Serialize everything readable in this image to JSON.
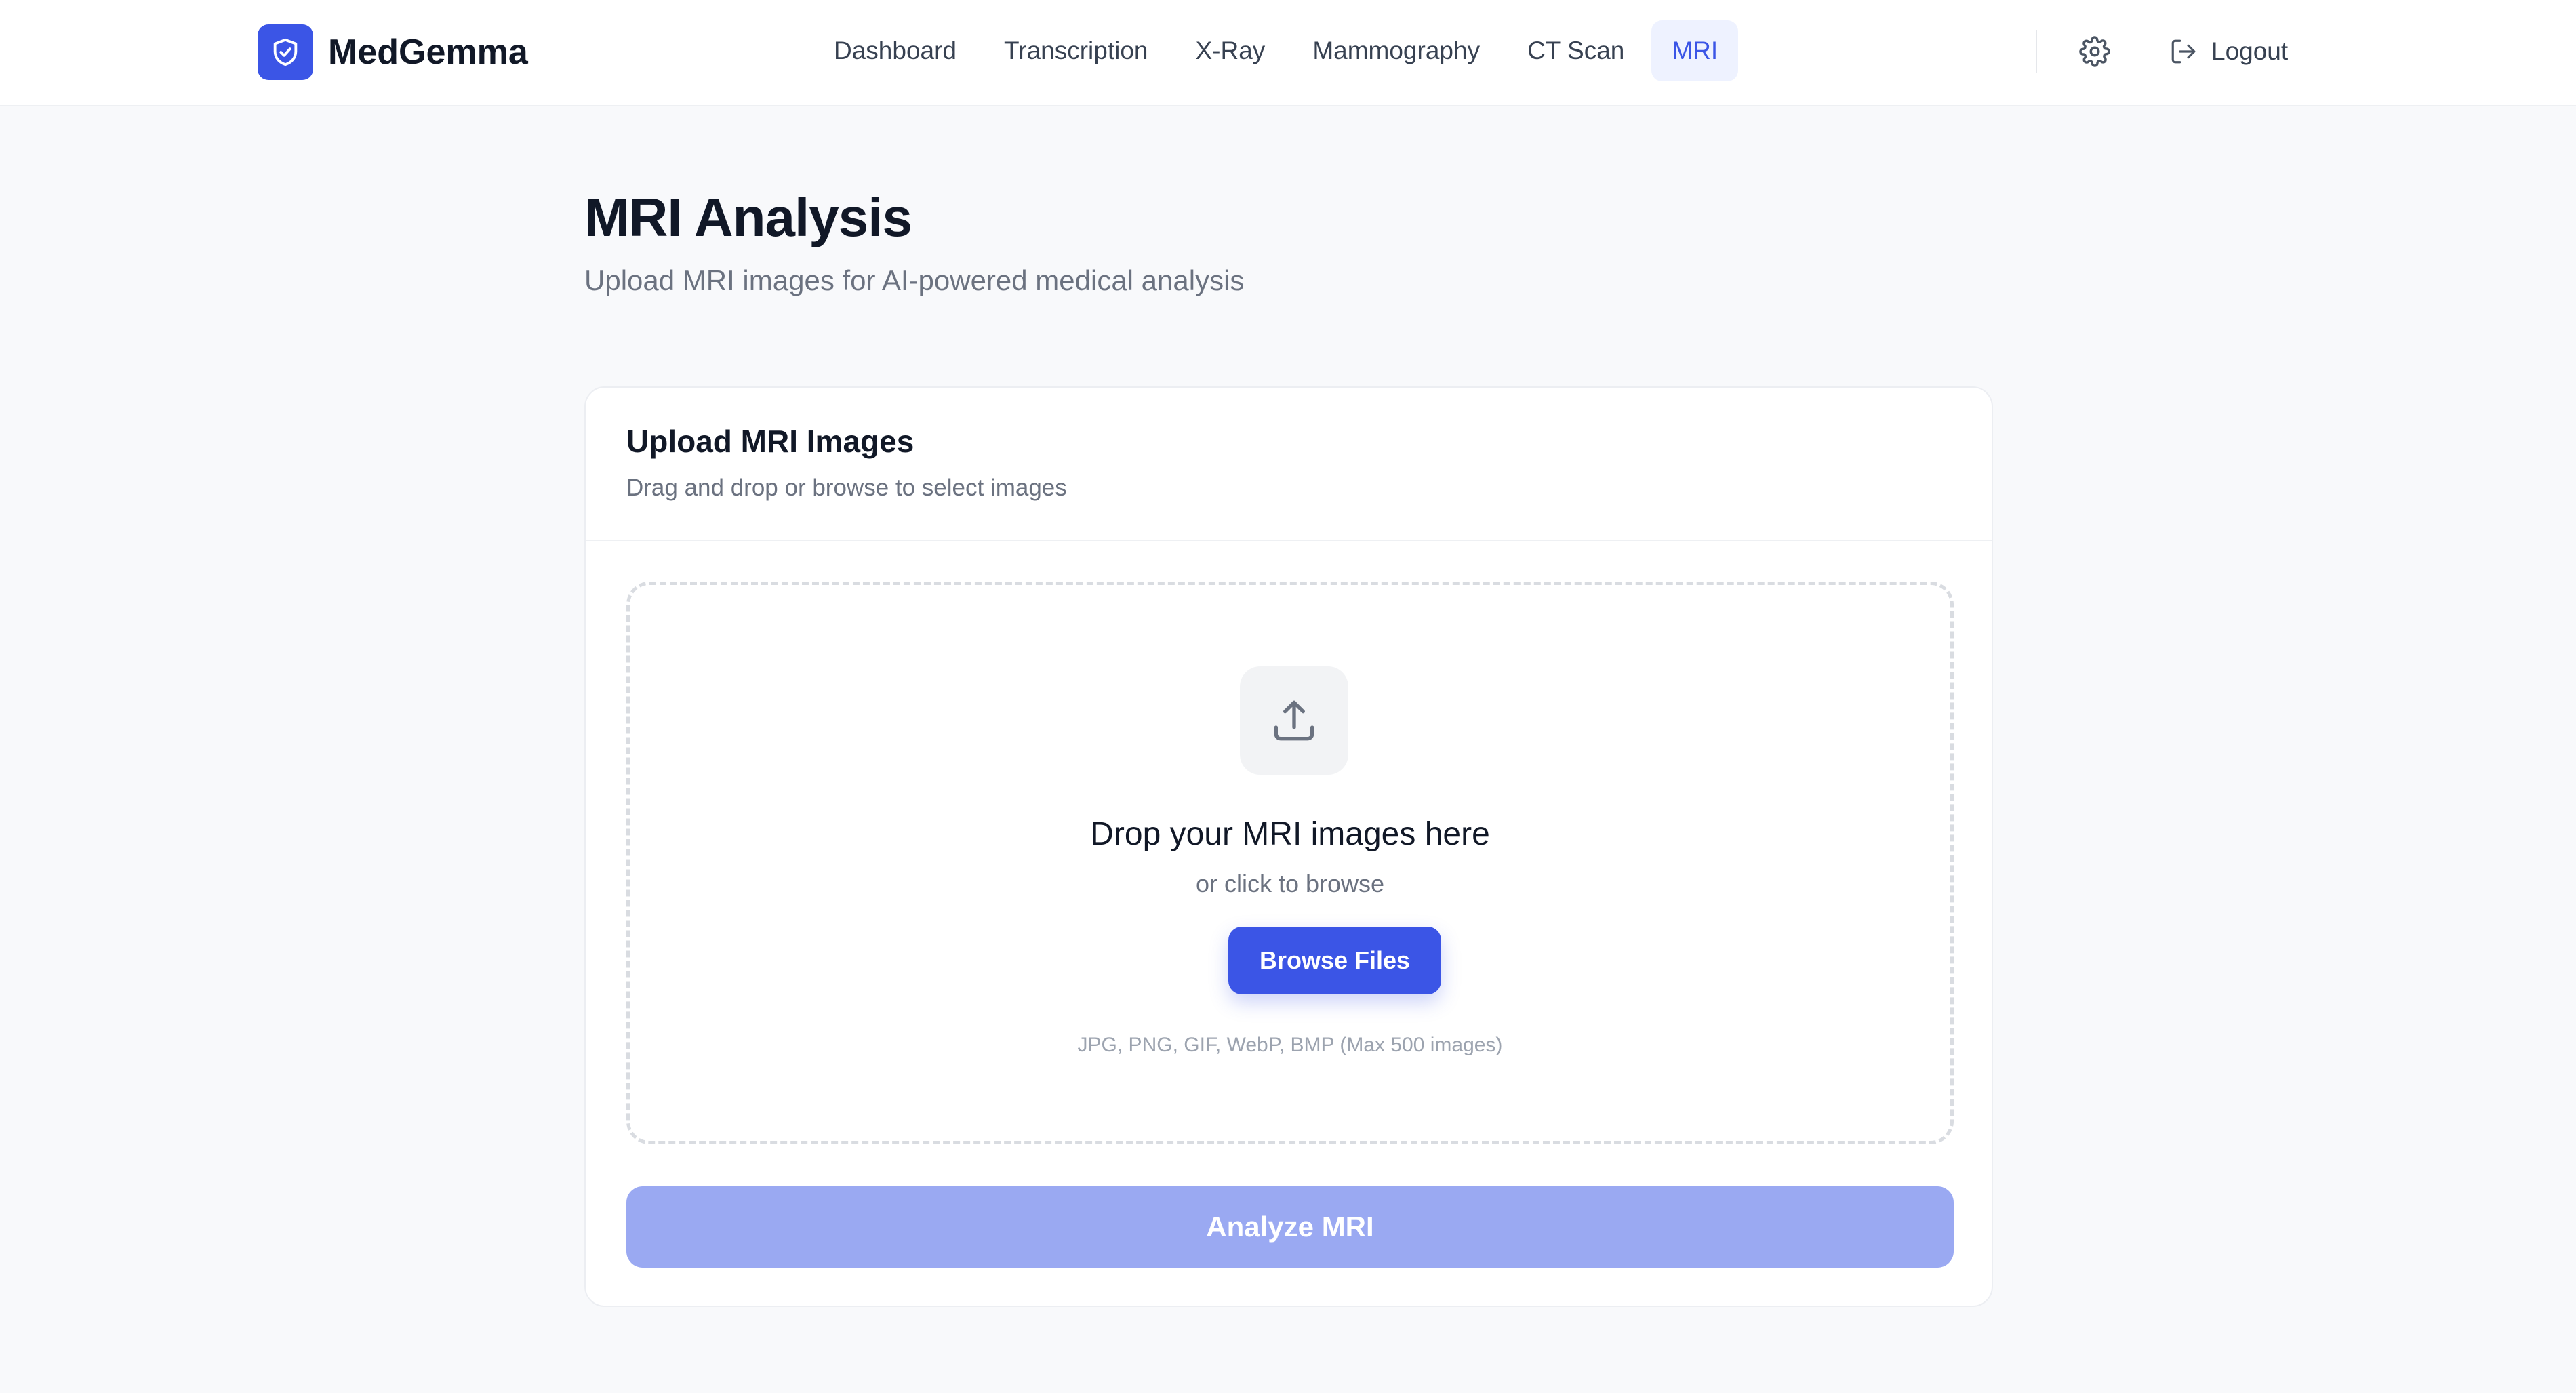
{
  "brand": {
    "name": "MedGemma",
    "logo_icon": "shield-check-icon",
    "accent_color": "#3b55e6"
  },
  "nav": {
    "items": [
      {
        "label": "Dashboard",
        "active": false
      },
      {
        "label": "Transcription",
        "active": false
      },
      {
        "label": "X-Ray",
        "active": false
      },
      {
        "label": "Mammography",
        "active": false
      },
      {
        "label": "CT Scan",
        "active": false
      },
      {
        "label": "MRI",
        "active": true
      }
    ],
    "settings_icon": "gear-icon",
    "logout_icon": "logout-icon",
    "logout_label": "Logout"
  },
  "page": {
    "title": "MRI Analysis",
    "subtitle": "Upload MRI images for AI-powered medical analysis"
  },
  "upload_card": {
    "title": "Upload MRI Images",
    "description": "Drag and drop or browse to select images",
    "dropzone": {
      "icon": "upload-icon",
      "title": "Drop your MRI images here",
      "subtitle": "or click to browse",
      "browse_label": "Browse Files",
      "formats": "JPG, PNG, GIF, WebP, BMP (Max 500 images)"
    },
    "analyze_label": "Analyze MRI",
    "analyze_enabled": false
  }
}
